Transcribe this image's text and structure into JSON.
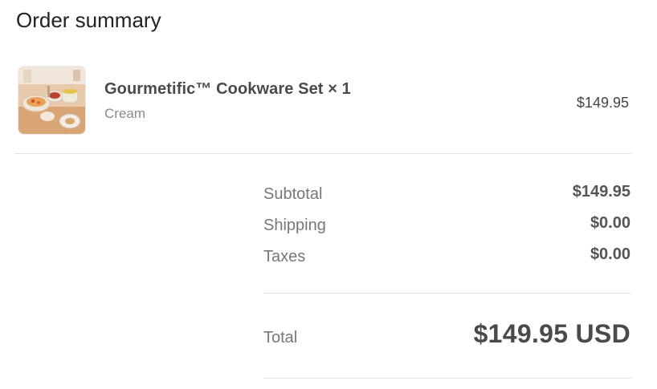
{
  "summary": {
    "title": "Order summary"
  },
  "product": {
    "name": "Gourmetific™ Cookware Set × 1",
    "variant": "Cream",
    "price": "$149.95",
    "image_icon": "cookware-set-thumbnail"
  },
  "totals": {
    "subtotal_label": "Subtotal",
    "subtotal_value": "$149.95",
    "shipping_label": "Shipping",
    "shipping_value": "$0.00",
    "taxes_label": "Taxes",
    "taxes_value": "$0.00",
    "total_label": "Total",
    "total_value": "$149.95 USD"
  }
}
